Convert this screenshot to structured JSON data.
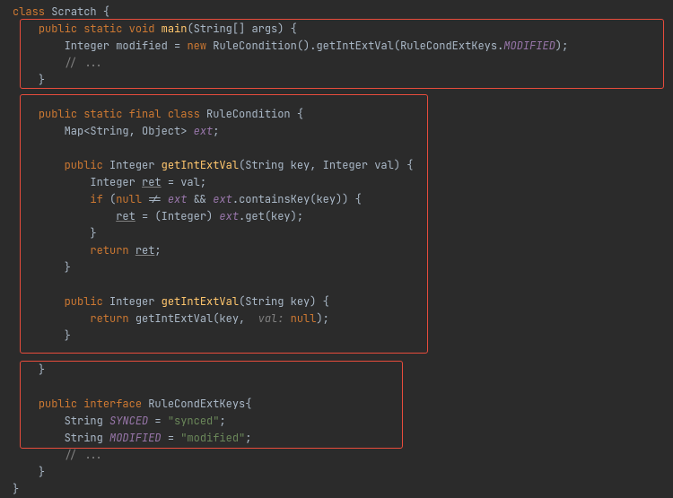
{
  "code": {
    "l1": {
      "kw_class": "class",
      "name": "Scratch",
      "brace": " {"
    },
    "l2": {
      "indent": "    ",
      "kw_mods": "public static void ",
      "fn": "main",
      "sig": "(String[] args) {"
    },
    "l3": {
      "indent": "        ",
      "type1": "Integer ",
      "var": "modified ",
      "eq": "= ",
      "kw_new": "new ",
      "ctor": "RuleCondition",
      "after_ctor": "().",
      "call": "getIntExtVal",
      "open": "(",
      "cls": "RuleCondExtKeys",
      "dot": ".",
      "const": "MODIFIED",
      "close": ");"
    },
    "l4": {
      "indent": "        ",
      "comment": "// ..."
    },
    "l5": {
      "indent": "    ",
      "brace": "}"
    },
    "l7": {
      "indent": "    ",
      "kw_mods": "public static final class ",
      "name": "RuleCondition",
      "brace": " {"
    },
    "l8": {
      "indent": "        ",
      "type": "Map<String, Object> ",
      "field": "ext",
      "semi": ";"
    },
    "l10": {
      "indent": "        ",
      "kw_pub": "public ",
      "ret": "Integer ",
      "fn": "getIntExtVal",
      "sig": "(String key, Integer val) {"
    },
    "l11": {
      "indent": "            ",
      "type": "Integer ",
      "var": "ret",
      "rest": " = val;"
    },
    "l12": {
      "indent": "            ",
      "kw_if": "if ",
      "open": "(",
      "kw_null": "null ",
      "neq": "!= ",
      "f1": "ext",
      "and": " && ",
      "f2": "ext",
      "call": ".containsKey(key)) {"
    },
    "l13": {
      "indent": "                ",
      "var": "ret",
      "eq": " = (Integer) ",
      "fld": "ext",
      "call": ".get(key);"
    },
    "l14": {
      "indent": "            ",
      "brace": "}"
    },
    "l15": {
      "indent": "            ",
      "kw_ret": "return ",
      "var": "ret",
      "semi": ";"
    },
    "l16": {
      "indent": "        ",
      "brace": "}"
    },
    "l18": {
      "indent": "        ",
      "kw_pub": "public ",
      "ret": "Integer ",
      "fn": "getIntExtVal",
      "sig": "(String key) {"
    },
    "l19": {
      "indent": "            ",
      "kw_ret": "return ",
      "call": "getIntExtVal(key, ",
      "hint": " val: ",
      "kw_null": "null",
      "close": ");"
    },
    "l20": {
      "indent": "        ",
      "brace": "}"
    },
    "l22": {
      "indent": "    ",
      "brace": "}"
    },
    "l24": {
      "indent": "    ",
      "kw_mods": "public interface ",
      "name": "RuleCondExtKeys",
      "brace": "{"
    },
    "l25": {
      "indent": "        ",
      "type": "String ",
      "const": "SYNCED",
      "eq": " = ",
      "str": "\"synced\"",
      "semi": ";"
    },
    "l26": {
      "indent": "        ",
      "type": "String ",
      "const": "MODIFIED",
      "eq": " = ",
      "str": "\"modified\"",
      "semi": ";"
    },
    "l27": {
      "indent": "        ",
      "comment": "// ..."
    },
    "l28": {
      "indent": "    ",
      "brace": "}"
    },
    "l29": {
      "brace": "}"
    }
  }
}
